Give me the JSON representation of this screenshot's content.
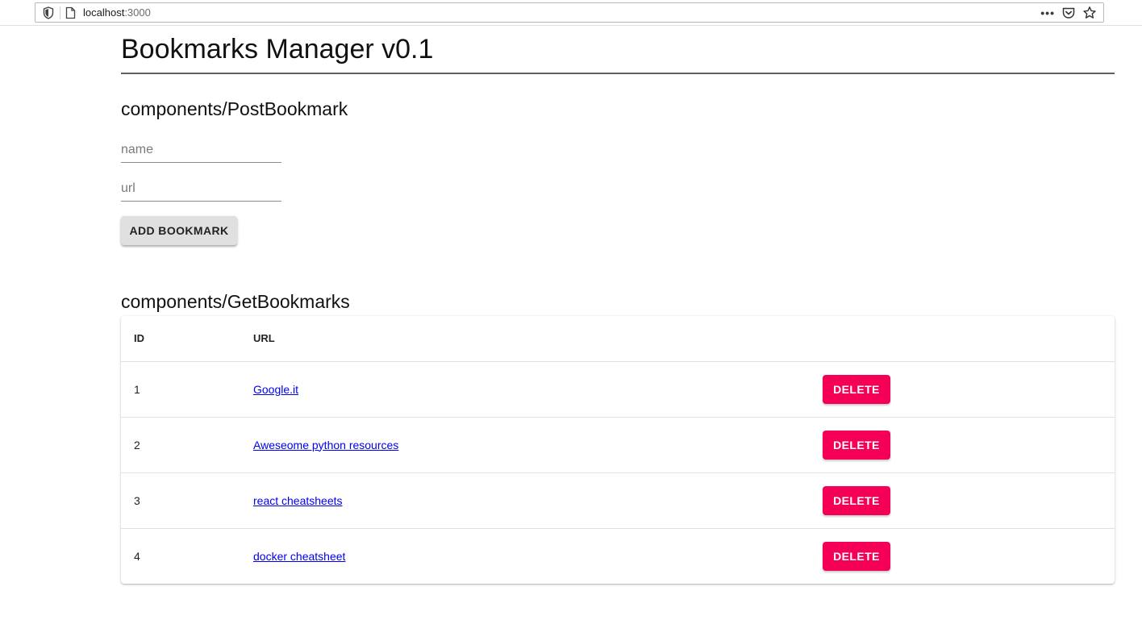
{
  "browser": {
    "url_host": "localhost",
    "url_port": ":3000"
  },
  "app": {
    "title": "Bookmarks Manager v0.1"
  },
  "post_bookmark": {
    "heading": "components/PostBookmark",
    "name_placeholder": "name",
    "name_value": "",
    "url_placeholder": "url",
    "url_value": "",
    "add_label": "ADD BOOKMARK"
  },
  "get_bookmarks": {
    "heading": "components/GetBookmarks",
    "columns": {
      "id": "ID",
      "url": "URL"
    },
    "rows": [
      {
        "id": "1",
        "name": "Google.it",
        "action": "DELETE"
      },
      {
        "id": "2",
        "name": "Aweseome python resources",
        "action": "DELETE"
      },
      {
        "id": "3",
        "name": "react cheatsheets",
        "action": "DELETE"
      },
      {
        "id": "4",
        "name": "docker cheatsheet",
        "action": "DELETE"
      }
    ]
  },
  "colors": {
    "delete_button": "#f50057",
    "add_button": "#e0e0e0",
    "link": "#0000ee"
  },
  "icons": [
    "shield-icon",
    "page-icon",
    "more-icon",
    "pocket-icon",
    "bookmark-star-icon"
  ]
}
